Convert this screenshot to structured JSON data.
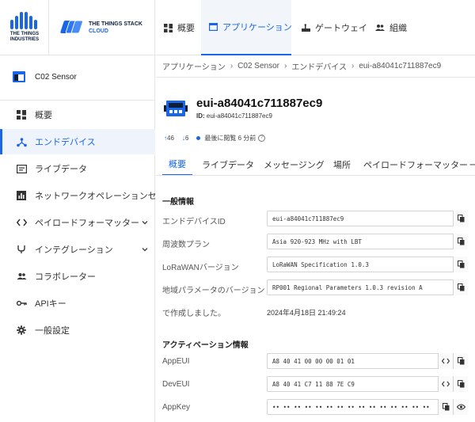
{
  "header": {
    "tti": {
      "line1": "THE THINGS",
      "line2": "INDUSTRIES"
    },
    "tts": {
      "line1": "THE THINGS STACK",
      "line2": "CLOUD"
    },
    "nav": [
      {
        "label": "概要",
        "icon": "grid-icon"
      },
      {
        "label": "アプリケーション",
        "icon": "window-icon"
      },
      {
        "label": "ゲートウェイ",
        "icon": "gateway-icon"
      },
      {
        "label": "組織",
        "icon": "people-icon"
      }
    ]
  },
  "sidebar": {
    "app_name": "C02 Sensor",
    "items": [
      {
        "label": "概要",
        "icon": "grid-icon"
      },
      {
        "label": "エンドデバイス",
        "icon": "device-network-icon"
      },
      {
        "label": "ライブデータ",
        "icon": "live-data-icon"
      },
      {
        "label": "ネットワークオペレーションセンター",
        "icon": "bar-chart-icon"
      },
      {
        "label": "ペイロードフォーマッター",
        "icon": "code-icon"
      },
      {
        "label": "インテグレーション",
        "icon": "integration-icon"
      },
      {
        "label": "コラボレーター",
        "icon": "people-icon"
      },
      {
        "label": "APIキー",
        "icon": "key-icon"
      },
      {
        "label": "一般設定",
        "icon": "gear-icon"
      }
    ]
  },
  "breadcrumb": [
    "アプリケーション",
    "C02 Sensor",
    "エンドデバイス",
    "eui-a84041c711887ec9"
  ],
  "device": {
    "title": "eui-a84041c711887ec9",
    "id_label": "ID:",
    "id_value": "eui-a84041c711887ec9",
    "uplinks": "46",
    "downlinks": "6",
    "last_seen": "最後に閲覧 6 分前",
    "help": "?"
  },
  "tabs": [
    "概要",
    "ライブデータ",
    "メッセージング",
    "場所",
    "ペイロードフォーマッター",
    "一"
  ],
  "general": {
    "title": "一般情報",
    "fields": [
      {
        "label": "エンドデバイスID",
        "value": "eui-a84041c711887ec9"
      },
      {
        "label": "周波数プラン",
        "value": "Asia 920-923 MHz with LBT"
      },
      {
        "label": "LoRaWANバージョン",
        "value": "LoRaWAN Specification 1.0.3"
      },
      {
        "label": "地域パラメータのバージョン",
        "value": "RP001 Regional Parameters 1.0.3 revision A"
      }
    ],
    "created_label": "で作成しました。",
    "created_value": "2024年4月18日 21:49:24"
  },
  "activation": {
    "title": "アクティベーション情報",
    "app_eui": {
      "label": "AppEUI",
      "value": "A8 40 41 00 00 00 01 01"
    },
    "dev_eui": {
      "label": "DevEUI",
      "value": "A8 40 41 C7 11 88 7E C9"
    },
    "app_key": {
      "label": "AppKey",
      "value": "•• •• •• •• •• •• •• •• •• •• •• •• •• •• •• ••"
    }
  },
  "colors": {
    "accent": "#1a66e6",
    "navy": "#0d1f3a"
  }
}
